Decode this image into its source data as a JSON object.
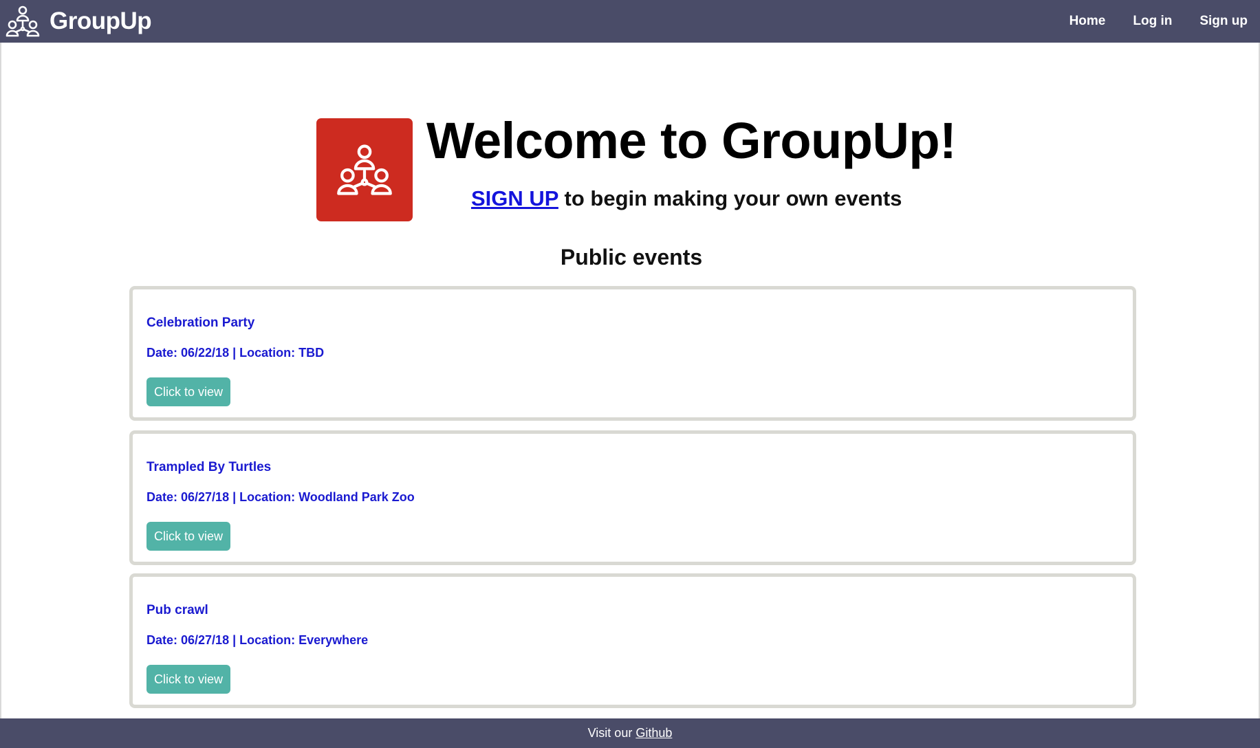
{
  "navbar": {
    "brand": "GroupUp",
    "links": [
      {
        "label": "Home"
      },
      {
        "label": "Log in"
      },
      {
        "label": "Sign up"
      }
    ]
  },
  "hero": {
    "title": "Welcome to GroupUp!",
    "signup_link": "SIGN UP",
    "signup_rest": " to begin making your own events"
  },
  "section_title": "Public events",
  "events": [
    {
      "name": "Celebration Party",
      "meta": "Date: 06/22/18 | Location: TBD",
      "button": "Click to view"
    },
    {
      "name": "Trampled By Turtles",
      "meta": "Date: 06/27/18 | Location: Woodland Park Zoo",
      "button": "Click to view"
    },
    {
      "name": "Pub crawl",
      "meta": "Date: 06/27/18 | Location: Everywhere",
      "button": "Click to view"
    }
  ],
  "footer": {
    "text": "Visit our",
    "link": "Github"
  },
  "colors": {
    "nav_bg": "#4a4c68",
    "logo_red": "#cd2b20",
    "link_blue": "#1a1ad0",
    "button_teal": "#52b3a7",
    "card_border": "#d9d9d3"
  }
}
